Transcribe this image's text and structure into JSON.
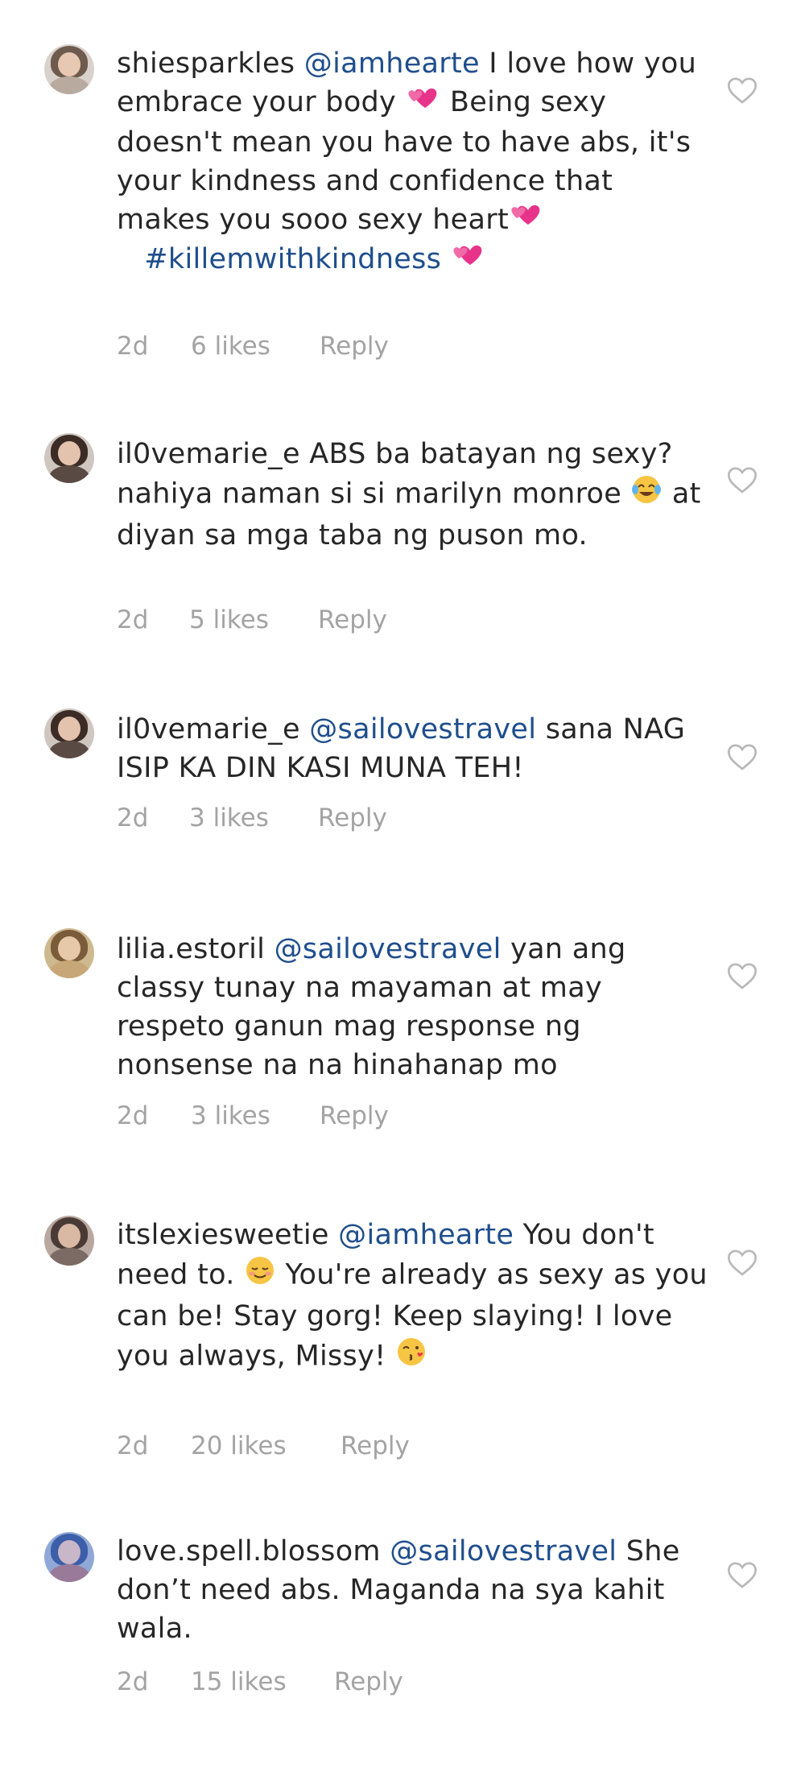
{
  "comments": [
    {
      "username": "shiesparkles",
      "mention": "@iamhearte",
      "text_a": " I love how you embrace your body ",
      "text_b": " Being sexy doesn't mean you have to have abs, it's your kindness and confidence that makes you sooo sexy heart",
      "hashtag": "#killemwithkindness",
      "time": "2d",
      "likes": "6 likes",
      "reply": "Reply"
    },
    {
      "username": "il0vemarie_e",
      "text_a": " ABS ba batayan ng sexy? nahiya naman si si marilyn monroe ",
      "text_b": " at diyan sa mga taba ng puson mo.",
      "time": "2d",
      "likes": "5 likes",
      "reply": "Reply"
    },
    {
      "username": "il0vemarie_e",
      "mention": "@sailovestravel",
      "text_a": " sana NAG ISIP KA DIN KASI MUNA TEH!",
      "time": "2d",
      "likes": "3 likes",
      "reply": "Reply"
    },
    {
      "username": "lilia.estoril",
      "mention": "@sailovestravel",
      "text_a": " yan ang classy tunay na mayaman at may respeto ganun mag response ng nonsense na na hinahanap mo",
      "time": "2d",
      "likes": "3 likes",
      "reply": "Reply"
    },
    {
      "username": "itslexiesweetie",
      "mention": "@iamhearte",
      "text_a": " You don't need to. ",
      "text_b": " You're already  as sexy as you can be! Stay gorg! Keep slaying! I love you always, Missy! ",
      "time": "2d",
      "likes": "20 likes",
      "reply": "Reply"
    },
    {
      "username": "love.spell.blossom",
      "mention": "@sailovestravel",
      "text_a": " She don’t need abs. Maganda na sya kahit wala.",
      "time": "2d",
      "likes": "15 likes",
      "reply": "Reply"
    }
  ],
  "icons": {
    "like": "heart-outline-icon",
    "emoji_hearts": "two-hearts-emoji",
    "emoji_laugh": "tears-of-joy-emoji",
    "emoji_smile": "relieved-smile-emoji",
    "emoji_kiss": "face-blowing-kiss-emoji"
  },
  "colors": {
    "text": "#262626",
    "link": "#1f4e8c",
    "meta": "#a3a3a3",
    "heart_outline": "#b8b8b8",
    "hearts_emoji": "#e8338b"
  }
}
